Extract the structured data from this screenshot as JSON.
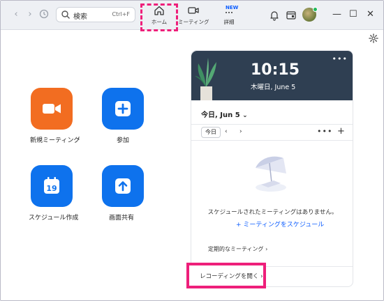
{
  "toolbar": {
    "search_placeholder": "検索",
    "search_shortcut": "Ctrl+F",
    "tabs": [
      {
        "label": "ホーム",
        "icon": "home-icon",
        "selected": true
      },
      {
        "label": "ミーティング",
        "icon": "video-camera-icon"
      },
      {
        "label": "詳細",
        "icon": "more-icon",
        "badge": "NEW"
      }
    ],
    "right_icons": [
      "bell-icon",
      "whiteboard-icon",
      "avatar"
    ]
  },
  "actions": [
    {
      "label": "新規ミーティング",
      "icon": "video-camera-icon",
      "color": "#f26d21",
      "has_chevron": true
    },
    {
      "label": "参加",
      "icon": "plus-icon",
      "color": "#0e72ed"
    },
    {
      "label": "スケジュール作成",
      "icon": "calendar-icon",
      "color": "#0e72ed",
      "calendar_day": "19"
    },
    {
      "label": "画面共有",
      "icon": "share-up-icon",
      "color": "#0e72ed"
    }
  ],
  "clock": {
    "time": "10:15",
    "date": "木曜日, June 5"
  },
  "calendar": {
    "heading": "今日, Jun 5",
    "today_button": "今日",
    "empty_message": "スケジュールされたミーティングはありません。",
    "schedule_link": "ミーティングをスケジュール",
    "recurring_label": "定期的なミーティング",
    "recording_label": "レコーディングを開く"
  },
  "colors": {
    "accent_blue": "#0e72ed",
    "accent_orange": "#f26d21",
    "highlight_pink": "#ee1f7a",
    "clock_bg": "#2f3f52"
  }
}
